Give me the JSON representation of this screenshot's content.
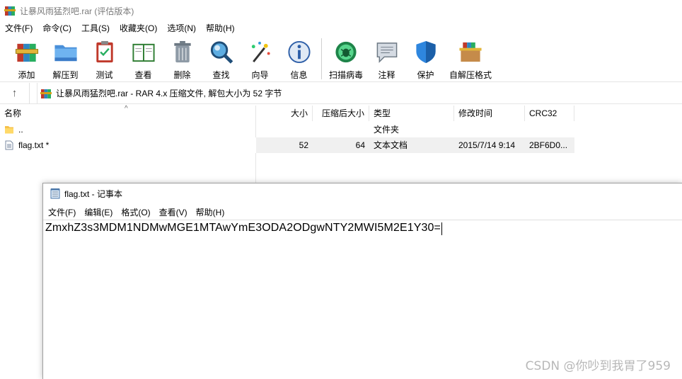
{
  "window": {
    "title": "让暴风雨猛烈吧.rar (评估版本)"
  },
  "menu": [
    {
      "label": "文件(F)"
    },
    {
      "label": "命令(C)"
    },
    {
      "label": "工具(S)"
    },
    {
      "label": "收藏夹(O)"
    },
    {
      "label": "选项(N)"
    },
    {
      "label": "帮助(H)"
    }
  ],
  "toolbar": {
    "add": "添加",
    "extract_to": "解压到",
    "test": "测试",
    "view": "查看",
    "delete": "删除",
    "find": "查找",
    "wizard": "向导",
    "info": "信息",
    "virus_scan": "扫描病毒",
    "comment": "注释",
    "protect": "保护",
    "sfx": "自解压格式"
  },
  "pathbar": {
    "up_icon": "arrow-up-icon",
    "text": "让暴风雨猛烈吧.rar - RAR 4.x 压缩文件, 解包大小为 52 字节"
  },
  "columns": {
    "name": "名称",
    "size": "大小",
    "packed": "压缩后大小",
    "type": "类型",
    "modified": "修改时间",
    "crc": "CRC32"
  },
  "files": [
    {
      "name": "..",
      "size": "",
      "packed": "",
      "type": "文件夹",
      "modified": "",
      "crc": ""
    },
    {
      "name": "flag.txt *",
      "size": "52",
      "packed": "64",
      "type": "文本文档",
      "modified": "2015/7/14 9:14",
      "crc": "2BF6D0..."
    }
  ],
  "notepad": {
    "title": "flag.txt - 记事本",
    "menu": [
      {
        "label": "文件(F)"
      },
      {
        "label": "编辑(E)"
      },
      {
        "label": "格式(O)"
      },
      {
        "label": "查看(V)"
      },
      {
        "label": "帮助(H)"
      }
    ],
    "content": "ZmxhZ3s3MDM1NDMwMGE1MTAwYmE3ODA2ODgwNTY2MWI5M2E1Y30="
  },
  "watermark": "CSDN @你吵到我胃了959"
}
